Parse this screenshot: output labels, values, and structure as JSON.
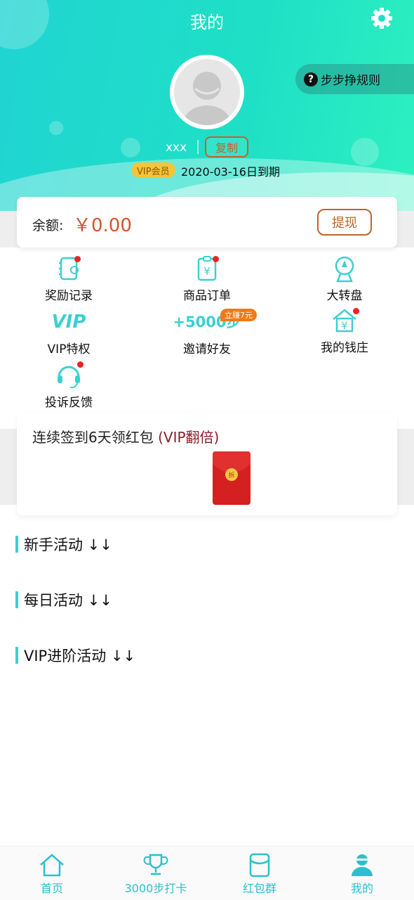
{
  "header": {
    "title": "我的",
    "rules_label": "步步挣规则"
  },
  "profile": {
    "name": "xxx",
    "copy_label": "复制",
    "vip_badge": "VIP会员",
    "expire_text": "2020-03-16日到期"
  },
  "balance": {
    "label": "余额:",
    "value": "￥0.00",
    "withdraw_label": "提现"
  },
  "grid": {
    "reward": "奖励记录",
    "orders": "商品订单",
    "wheel": "大转盘",
    "vip_icon_text": "VIP",
    "vip": "VIP特权",
    "invite_icon_text": "+5000步",
    "invite_tag": "立赚7元",
    "invite": "邀请好友",
    "bank": "我的钱庄",
    "feedback": "投诉反馈"
  },
  "signin": {
    "title": "连续签到6天领红包 ",
    "highlight": "(VIP翻倍)",
    "coin": "拆"
  },
  "sections": {
    "newbie": "新手活动 ↓↓",
    "daily": "每日活动 ↓↓",
    "vip": "VIP进阶活动 ↓↓"
  },
  "tabs": {
    "home": "首页",
    "checkin": "3000步打卡",
    "group": "红包群",
    "mine": "我的"
  },
  "colors": {
    "accent": "#3ecfd0",
    "orange": "#c0632a",
    "red_dot": "#e22222",
    "header_start": "#20d4d2",
    "header_end": "#2df0c0"
  }
}
